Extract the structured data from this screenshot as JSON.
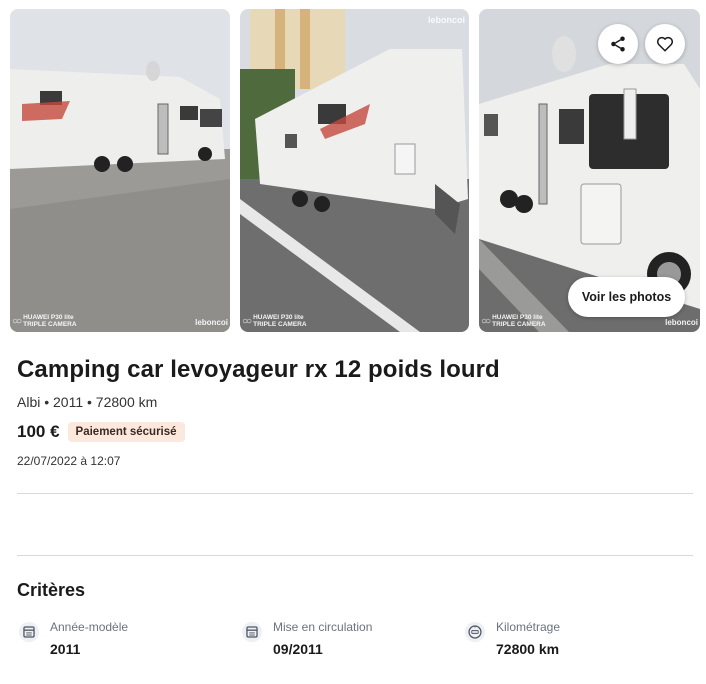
{
  "gallery": {
    "watermark_top": "leboncoi",
    "camera_brand": "HUAWEI P30 lite",
    "camera_line2": "TRIPLE CAMERA",
    "watermark_bottom": "leboncoi",
    "see_photos_label": "Voir les photos",
    "icons": {
      "share": "share-icon",
      "favorite": "heart-icon"
    }
  },
  "ad": {
    "title": "Camping car levoyageur rx 12 poids lourd",
    "subtitle": "Albi • 2011 • 72800 km",
    "price": "100 €",
    "payment_badge": "Paiement sécurisé",
    "date": "22/07/2022 à 12:07"
  },
  "criteria": {
    "title": "Critères",
    "items": [
      {
        "label": "Année-modèle",
        "value": "2011",
        "icon": "calendar-icon"
      },
      {
        "label": "Mise en circulation",
        "value": "09/2011",
        "icon": "calendar-icon"
      },
      {
        "label": "Kilométrage",
        "value": "72800 km",
        "icon": "odometer-icon"
      }
    ]
  },
  "colors": {
    "badge_bg": "#fde8de",
    "text": "#1a1a1a",
    "muted": "#6b7280"
  }
}
